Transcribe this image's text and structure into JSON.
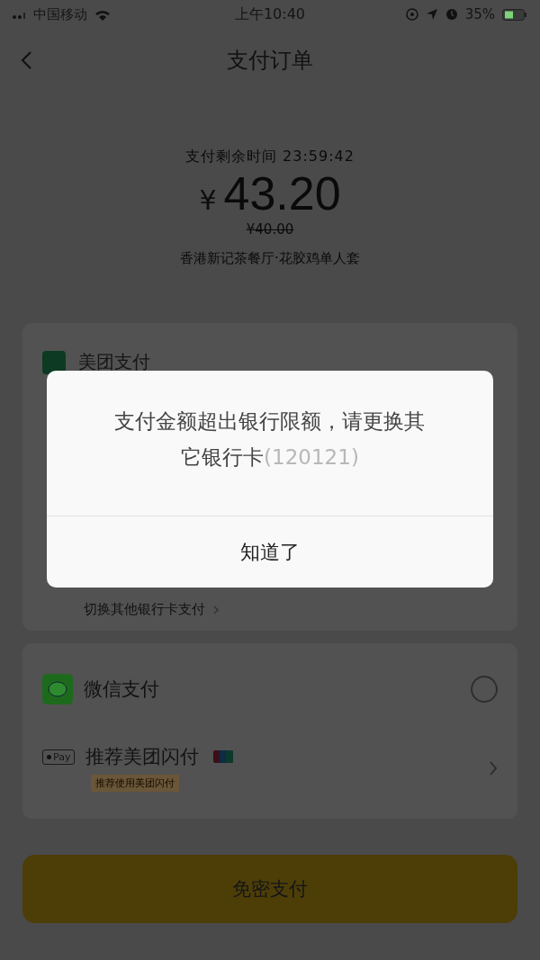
{
  "status_bar": {
    "carrier": "中国移动",
    "time": "上午10:40",
    "battery": "35%"
  },
  "nav": {
    "title": "支付订单"
  },
  "order": {
    "countdown": "支付剩余时间 23:59:42",
    "currency": "¥",
    "amount": "43.20",
    "original_price": "¥40.00",
    "merchant": "香港新记茶餐厅·花胶鸡单人套"
  },
  "bank_card": {
    "method": "美团支付",
    "switch_link": "切换其他银行卡支付"
  },
  "payment_methods": [
    {
      "kind": "radio",
      "name": "微信支付",
      "selected": false
    },
    {
      "kind": "link",
      "name": "推荐美团闪付",
      "badge": "Pay",
      "tag": "推荐使用美团闪付"
    }
  ],
  "pay_button": "免密支付",
  "dialog": {
    "message": "支付金额超出银行限额，请更换其它银行卡",
    "code": "(120121)",
    "button": "知道了"
  }
}
